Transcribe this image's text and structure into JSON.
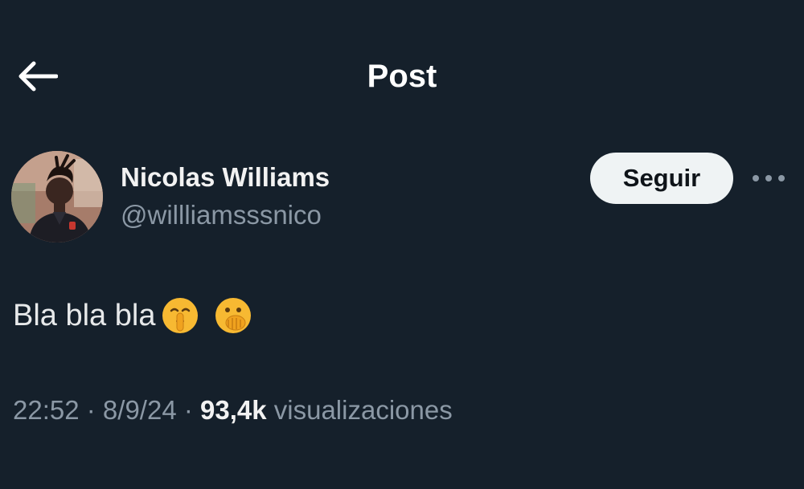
{
  "header": {
    "title": "Post",
    "back_icon": "arrow-left-icon"
  },
  "author": {
    "display_name": "Nicolas Williams",
    "handle": "@willliamsssnico",
    "avatar": "profile-photo"
  },
  "actions": {
    "follow_label": "Seguir",
    "more_icon": "more-horizontal-icon"
  },
  "post": {
    "text": "Bla bla bla",
    "emojis": [
      "shushing-face-emoji",
      "face-with-hand-over-mouth-emoji"
    ]
  },
  "meta": {
    "time": "22:52",
    "separator": " · ",
    "date": "8/9/24",
    "views_count": "93,4k",
    "views_label": "visualizaciones"
  },
  "colors": {
    "background": "#15202b",
    "primary_text": "#e7e9ea",
    "secondary_text": "#8b98a5",
    "button_bg": "#eff3f4"
  }
}
